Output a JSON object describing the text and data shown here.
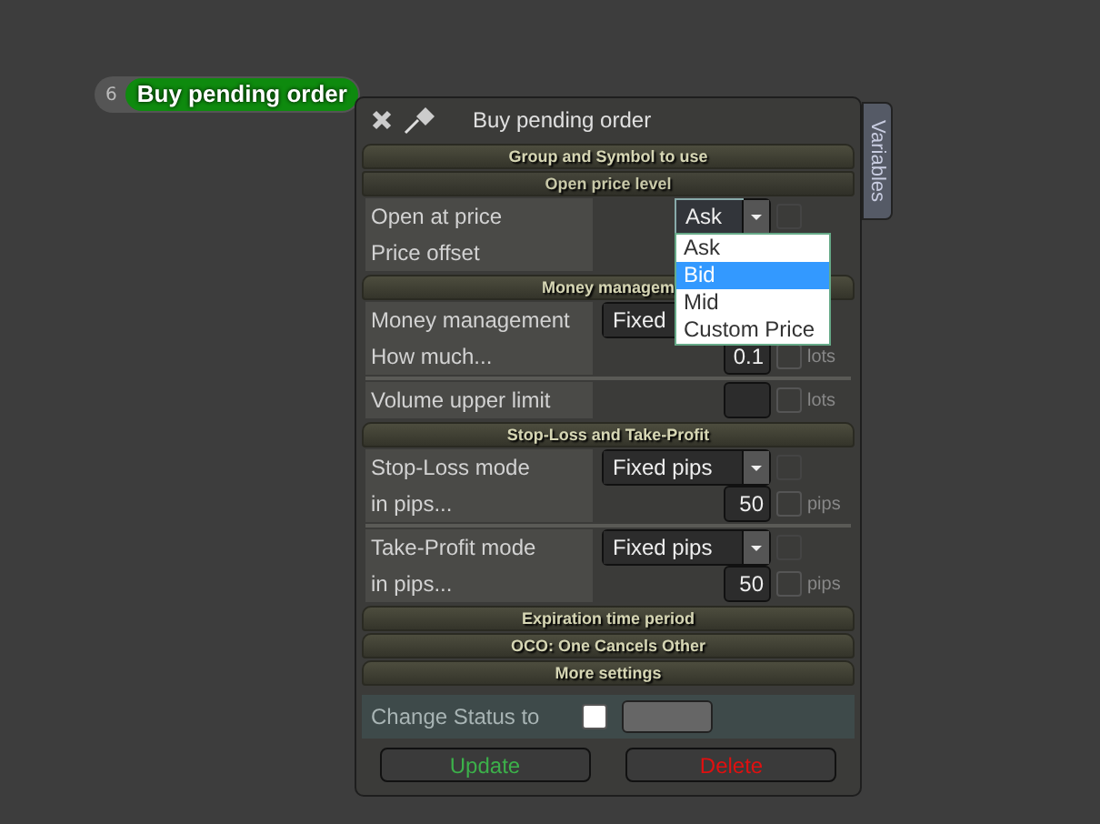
{
  "node": {
    "number": "6",
    "label": "Buy pending order"
  },
  "dialog": {
    "title": "Buy pending order",
    "side_tab": "Variables",
    "sections": [
      {
        "title": "Group and Symbol to use",
        "kind": "header"
      },
      {
        "title": "Open price level",
        "kind": "subheader",
        "groups": [
          [
            {
              "kind": "dropdown",
              "label": "Open at price",
              "value": "Ask",
              "open": true,
              "checked": false,
              "options": [
                {
                  "label": "Ask",
                  "highlighted": false
                },
                {
                  "label": "Bid",
                  "highlighted": true
                },
                {
                  "label": "Mid",
                  "highlighted": false
                },
                {
                  "label": "Custom Price",
                  "highlighted": false
                }
              ]
            },
            {
              "kind": "label",
              "label": "Price offset"
            }
          ]
        ]
      },
      {
        "title": "Money managem",
        "kind": "header",
        "groups": [
          [
            {
              "kind": "dropdown",
              "label": "Money management",
              "value": "Fixed",
              "open": false
            },
            {
              "kind": "number",
              "label": "How much...",
              "value": "0.1",
              "unit": "lots",
              "checked": false
            }
          ],
          [
            {
              "kind": "number",
              "label": "Volume upper limit",
              "unit": "lots",
              "checked": false
            }
          ]
        ]
      },
      {
        "title": "Stop-Loss and Take-Profit",
        "kind": "header",
        "groups": [
          [
            {
              "kind": "dropdown",
              "label": "Stop-Loss mode",
              "value": "Fixed pips",
              "open": false,
              "checked": false
            },
            {
              "kind": "number",
              "label": "in pips...",
              "value": "50",
              "unit": "pips",
              "checked": false
            }
          ],
          [
            {
              "kind": "dropdown",
              "label": "Take-Profit mode",
              "value": "Fixed pips",
              "open": false,
              "checked": false
            },
            {
              "kind": "number",
              "label": "in pips...",
              "value": "50",
              "unit": "pips",
              "checked": false
            }
          ]
        ]
      },
      {
        "title": "Expiration time period",
        "kind": "header"
      },
      {
        "title": "OCO: One Cancels Other",
        "kind": "header"
      },
      {
        "title": "More settings",
        "kind": "header"
      }
    ],
    "status": {
      "label": "Change Status to",
      "checked": false
    },
    "buttons": [
      {
        "label": "Update",
        "kind": "update"
      },
      {
        "label": "Delete",
        "kind": "delete"
      }
    ]
  }
}
